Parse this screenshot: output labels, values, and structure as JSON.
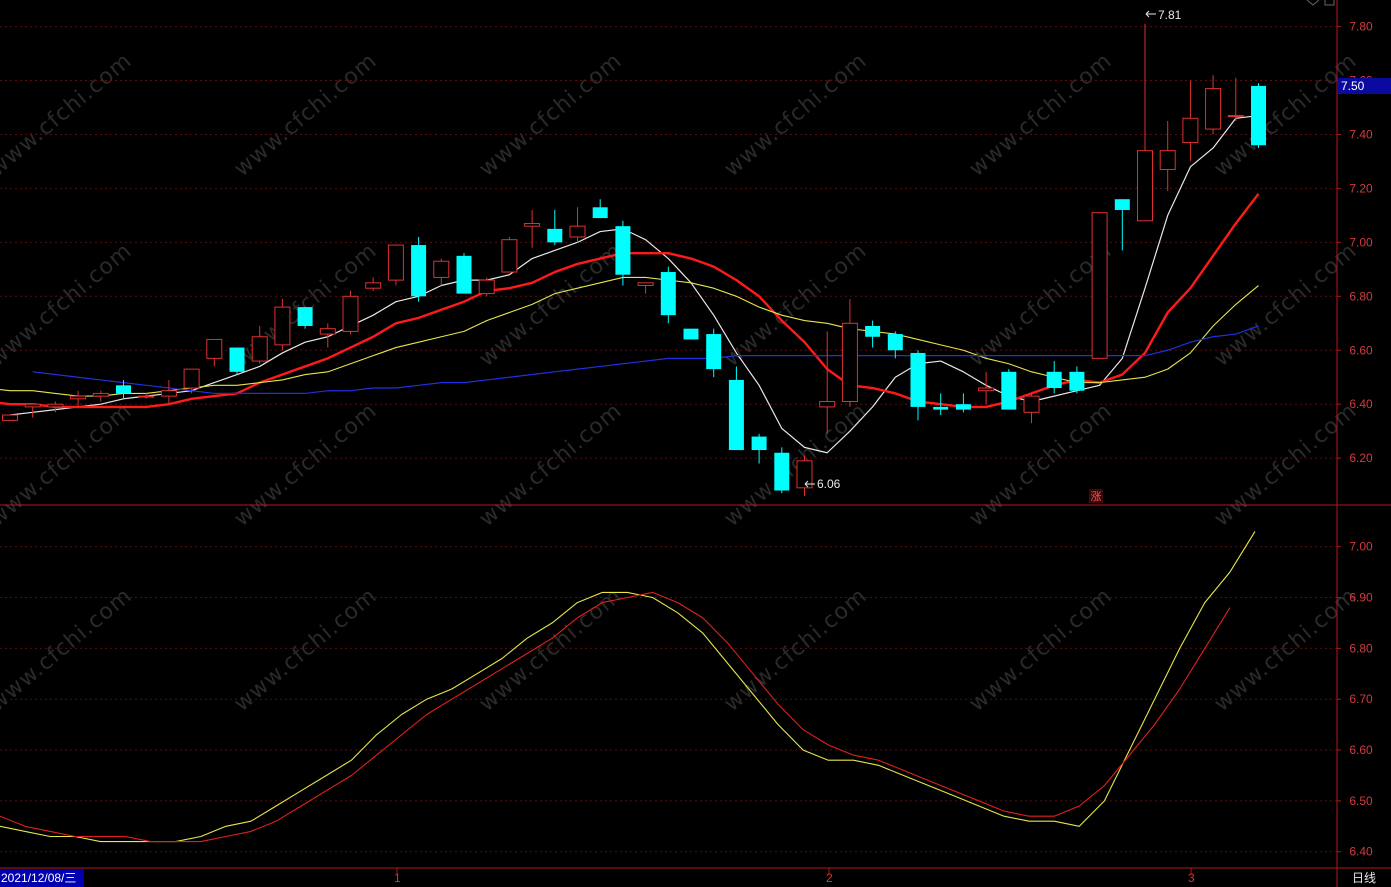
{
  "colors": {
    "background": "#000000",
    "axis": "#b01818",
    "grid": "#5a1010",
    "up_candle": "#e03030",
    "down_candle": "#00ffff",
    "ma_white": "#e8e8e8",
    "ma_red": "#ff1a1a",
    "ma_yellow": "#e6e64a",
    "ma_blue": "#2030e0",
    "price_tag_bg": "#0a0aa0",
    "price_tag_text": "#ffffff",
    "lower_yellow": "#e6e64a",
    "lower_red": "#e02020"
  },
  "watermark": "www.cfchi.com",
  "current_price_tag": "7.50",
  "rise_marker": "涨",
  "date_label": "2021/12/08/三",
  "period_label": "日线",
  "max_annotation": "7.81",
  "min_annotation": "6.06",
  "chart_data": [
    {
      "type": "candlestick",
      "panel": "upper",
      "ylim": [
        6.03,
        7.88
      ],
      "y_ticks": [
        "6.20",
        "6.40",
        "6.60",
        "6.80",
        "7.00",
        "7.20",
        "7.40",
        "7.60",
        "7.80"
      ],
      "x_ticks": [
        "1",
        "2",
        "3"
      ],
      "candles": [
        {
          "o": 6.34,
          "h": 6.36,
          "l": 6.34,
          "c": 6.36
        },
        {
          "o": 6.39,
          "h": 6.4,
          "l": 6.35,
          "c": 6.4
        },
        {
          "o": 6.39,
          "h": 6.41,
          "l": 6.37,
          "c": 6.4
        },
        {
          "o": 6.42,
          "h": 6.45,
          "l": 6.39,
          "c": 6.43
        },
        {
          "o": 6.43,
          "h": 6.45,
          "l": 6.41,
          "c": 6.44
        },
        {
          "o": 6.47,
          "h": 6.49,
          "l": 6.42,
          "c": 6.44
        },
        {
          "o": 6.43,
          "h": 6.44,
          "l": 6.42,
          "c": 6.43
        },
        {
          "o": 6.43,
          "h": 6.49,
          "l": 6.4,
          "c": 6.45
        },
        {
          "o": 6.46,
          "h": 6.53,
          "l": 6.44,
          "c": 6.53
        },
        {
          "o": 6.57,
          "h": 6.64,
          "l": 6.54,
          "c": 6.64
        },
        {
          "o": 6.61,
          "h": 6.61,
          "l": 6.51,
          "c": 6.52
        },
        {
          "o": 6.56,
          "h": 6.69,
          "l": 6.55,
          "c": 6.65
        },
        {
          "o": 6.62,
          "h": 6.79,
          "l": 6.6,
          "c": 6.76
        },
        {
          "o": 6.76,
          "h": 6.76,
          "l": 6.68,
          "c": 6.69
        },
        {
          "o": 6.66,
          "h": 6.7,
          "l": 6.61,
          "c": 6.68
        },
        {
          "o": 6.67,
          "h": 6.82,
          "l": 6.66,
          "c": 6.8
        },
        {
          "o": 6.83,
          "h": 6.87,
          "l": 6.82,
          "c": 6.85
        },
        {
          "o": 6.86,
          "h": 6.99,
          "l": 6.84,
          "c": 6.99
        },
        {
          "o": 6.99,
          "h": 7.02,
          "l": 6.78,
          "c": 6.8
        },
        {
          "o": 6.87,
          "h": 6.94,
          "l": 6.84,
          "c": 6.93
        },
        {
          "o": 6.95,
          "h": 6.96,
          "l": 6.83,
          "c": 6.81
        },
        {
          "o": 6.81,
          "h": 6.87,
          "l": 6.8,
          "c": 6.86
        },
        {
          "o": 6.89,
          "h": 7.02,
          "l": 6.89,
          "c": 7.01
        },
        {
          "o": 7.06,
          "h": 7.12,
          "l": 6.98,
          "c": 7.07
        },
        {
          "o": 7.05,
          "h": 7.12,
          "l": 6.99,
          "c": 7.0
        },
        {
          "o": 7.02,
          "h": 7.13,
          "l": 7.0,
          "c": 7.06
        },
        {
          "o": 7.13,
          "h": 7.16,
          "l": 7.1,
          "c": 7.09
        },
        {
          "o": 7.06,
          "h": 7.08,
          "l": 6.84,
          "c": 6.88
        },
        {
          "o": 6.84,
          "h": 6.85,
          "l": 6.81,
          "c": 6.85
        },
        {
          "o": 6.89,
          "h": 6.91,
          "l": 6.7,
          "c": 6.73
        },
        {
          "o": 6.68,
          "h": 6.68,
          "l": 6.64,
          "c": 6.64
        },
        {
          "o": 6.66,
          "h": 6.68,
          "l": 6.5,
          "c": 6.53
        },
        {
          "o": 6.49,
          "h": 6.54,
          "l": 6.23,
          "c": 6.23
        },
        {
          "o": 6.28,
          "h": 6.29,
          "l": 6.18,
          "c": 6.23
        },
        {
          "o": 6.22,
          "h": 6.24,
          "l": 6.07,
          "c": 6.08
        },
        {
          "o": 6.09,
          "h": 6.21,
          "l": 6.06,
          "c": 6.19
        },
        {
          "o": 6.39,
          "h": 6.67,
          "l": 6.29,
          "c": 6.41
        },
        {
          "o": 6.41,
          "h": 6.79,
          "l": 6.39,
          "c": 6.7
        },
        {
          "o": 6.69,
          "h": 6.71,
          "l": 6.61,
          "c": 6.65
        },
        {
          "o": 6.66,
          "h": 6.67,
          "l": 6.57,
          "c": 6.6
        },
        {
          "o": 6.59,
          "h": 6.6,
          "l": 6.34,
          "c": 6.39
        },
        {
          "o": 6.39,
          "h": 6.44,
          "l": 6.36,
          "c": 6.38
        },
        {
          "o": 6.4,
          "h": 6.44,
          "l": 6.37,
          "c": 6.38
        },
        {
          "o": 6.45,
          "h": 6.52,
          "l": 6.4,
          "c": 6.46
        },
        {
          "o": 6.52,
          "h": 6.53,
          "l": 6.38,
          "c": 6.38
        },
        {
          "o": 6.37,
          "h": 6.44,
          "l": 6.33,
          "c": 6.43
        },
        {
          "o": 6.52,
          "h": 6.56,
          "l": 6.44,
          "c": 6.46
        },
        {
          "o": 6.52,
          "h": 6.54,
          "l": 6.44,
          "c": 6.45
        },
        {
          "o": 6.57,
          "h": 7.11,
          "l": 6.57,
          "c": 7.11
        },
        {
          "o": 7.16,
          "h": 7.16,
          "l": 6.97,
          "c": 7.12
        },
        {
          "o": 7.08,
          "h": 7.81,
          "l": 7.08,
          "c": 7.34
        },
        {
          "o": 7.27,
          "h": 7.45,
          "l": 7.19,
          "c": 7.34
        },
        {
          "o": 7.37,
          "h": 7.6,
          "l": 7.3,
          "c": 7.46
        },
        {
          "o": 7.42,
          "h": 7.62,
          "l": 7.4,
          "c": 7.57
        },
        {
          "o": 7.47,
          "h": 7.61,
          "l": 7.45,
          "c": 7.47
        },
        {
          "o": 7.58,
          "h": 7.59,
          "l": 7.35,
          "c": 7.36
        }
      ],
      "series": [
        {
          "id": "ma_white",
          "values": [
            6.36,
            6.37,
            6.38,
            6.39,
            6.4,
            6.42,
            6.43,
            6.44,
            6.45,
            6.48,
            6.51,
            6.54,
            6.59,
            6.63,
            6.65,
            6.69,
            6.73,
            6.78,
            6.8,
            6.84,
            6.86,
            6.86,
            6.88,
            6.94,
            6.97,
            7.0,
            7.04,
            7.05,
            7.01,
            6.94,
            6.85,
            6.73,
            6.59,
            6.47,
            6.31,
            6.24,
            6.22,
            6.3,
            6.39,
            6.5,
            6.55,
            6.56,
            6.52,
            6.47,
            6.43,
            6.41,
            6.43,
            6.45,
            6.47,
            6.57,
            6.83,
            7.1,
            7.28,
            7.35,
            7.46,
            7.47
          ]
        },
        {
          "id": "ma_red",
          "values": [
            6.42,
            6.41,
            6.4,
            6.4,
            6.39,
            6.39,
            6.39,
            6.39,
            6.39,
            6.4,
            6.42,
            6.43,
            6.44,
            6.48,
            6.51,
            6.54,
            6.57,
            6.61,
            6.65,
            6.7,
            6.72,
            6.75,
            6.78,
            6.82,
            6.83,
            6.85,
            6.89,
            6.92,
            6.94,
            6.96,
            6.96,
            6.96,
            6.94,
            6.91,
            6.86,
            6.8,
            6.71,
            6.63,
            6.53,
            6.47,
            6.46,
            6.44,
            6.41,
            6.4,
            6.39,
            6.39,
            6.41,
            6.44,
            6.47,
            6.49,
            6.48,
            6.51,
            6.59,
            6.74,
            6.83,
            6.95,
            7.07,
            7.18
          ]
        },
        {
          "id": "ma_yellow",
          "values": [
            6.46,
            6.46,
            6.45,
            6.45,
            6.44,
            6.43,
            6.43,
            6.44,
            6.44,
            6.45,
            6.46,
            6.47,
            6.47,
            6.48,
            6.49,
            6.51,
            6.52,
            6.55,
            6.58,
            6.61,
            6.63,
            6.65,
            6.67,
            6.71,
            6.74,
            6.77,
            6.81,
            6.83,
            6.85,
            6.87,
            6.87,
            6.86,
            6.85,
            6.83,
            6.8,
            6.76,
            6.73,
            6.71,
            6.7,
            6.68,
            6.67,
            6.66,
            6.64,
            6.62,
            6.6,
            6.57,
            6.55,
            6.52,
            6.5,
            6.48,
            6.48,
            6.49,
            6.5,
            6.53,
            6.59,
            6.69,
            6.77,
            6.84
          ]
        },
        {
          "id": "ma_blue",
          "values": [
            6.52,
            6.51,
            6.5,
            6.49,
            6.48,
            6.47,
            6.46,
            6.45,
            6.44,
            6.44,
            6.44,
            6.44,
            6.44,
            6.45,
            6.45,
            6.46,
            6.46,
            6.47,
            6.48,
            6.48,
            6.49,
            6.5,
            6.51,
            6.52,
            6.53,
            6.54,
            6.55,
            6.56,
            6.57,
            6.57,
            6.57,
            6.58,
            6.58,
            6.58,
            6.58,
            6.58,
            6.58,
            6.58,
            6.58,
            6.58,
            6.58,
            6.58,
            6.58,
            6.58,
            6.58,
            6.58,
            6.58,
            6.58,
            6.58,
            6.58,
            6.6,
            6.63,
            6.65,
            6.66,
            6.69
          ]
        }
      ]
    },
    {
      "type": "line",
      "panel": "lower",
      "ylim": [
        6.37,
        7.08
      ],
      "y_ticks": [
        "6.40",
        "6.50",
        "6.60",
        "6.70",
        "6.80",
        "6.90",
        "7.00"
      ],
      "series": [
        {
          "id": "lower_yellow",
          "values": [
            6.45,
            6.44,
            6.43,
            6.43,
            6.42,
            6.42,
            6.42,
            6.42,
            6.43,
            6.45,
            6.46,
            6.49,
            6.52,
            6.55,
            6.58,
            6.63,
            6.67,
            6.7,
            6.72,
            6.75,
            6.78,
            6.82,
            6.85,
            6.89,
            6.91,
            6.91,
            6.9,
            6.87,
            6.83,
            6.77,
            6.71,
            6.65,
            6.6,
            6.58,
            6.58,
            6.57,
            6.55,
            6.53,
            6.51,
            6.49,
            6.47,
            6.46,
            6.46,
            6.45,
            6.5,
            6.6,
            6.7,
            6.8,
            6.89,
            6.95,
            7.03
          ]
        },
        {
          "id": "lower_red",
          "values": [
            6.47,
            6.45,
            6.44,
            6.43,
            6.43,
            6.43,
            6.42,
            6.42,
            6.42,
            6.43,
            6.44,
            6.46,
            6.49,
            6.52,
            6.55,
            6.59,
            6.63,
            6.67,
            6.7,
            6.73,
            6.76,
            6.79,
            6.82,
            6.86,
            6.89,
            6.9,
            6.91,
            6.89,
            6.86,
            6.81,
            6.75,
            6.69,
            6.64,
            6.61,
            6.59,
            6.58,
            6.56,
            6.54,
            6.52,
            6.5,
            6.48,
            6.47,
            6.47,
            6.49,
            6.53,
            6.59,
            6.65,
            6.72,
            6.8,
            6.88
          ]
        }
      ]
    }
  ]
}
